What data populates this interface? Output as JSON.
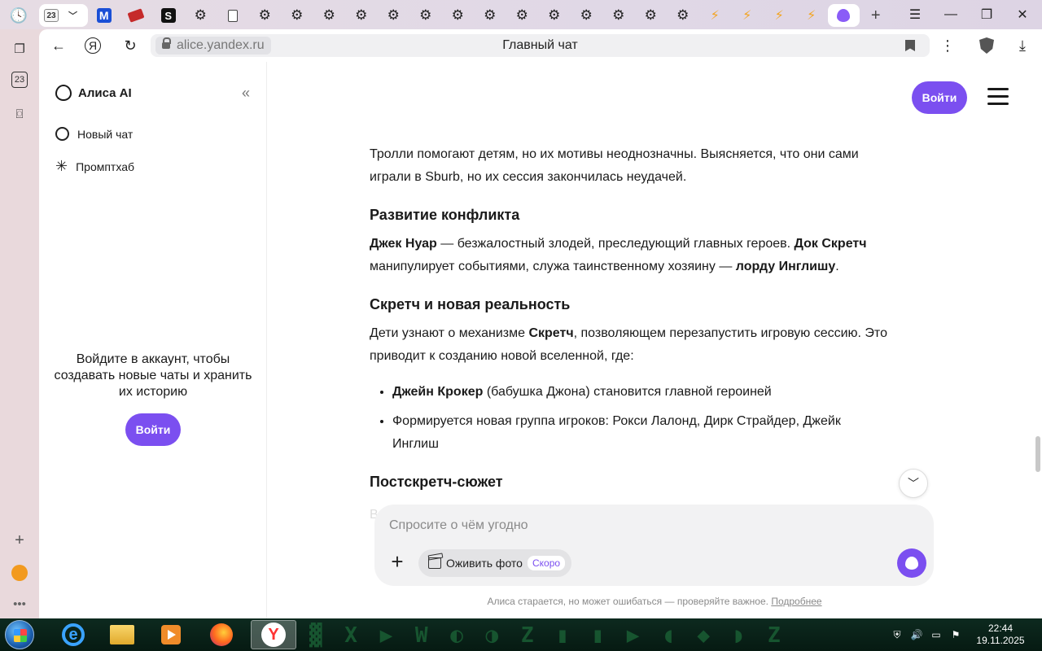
{
  "tabbar": {
    "first_tab_badge": "23",
    "tabs": [
      {
        "icon": "m-icon",
        "glyph": "M"
      },
      {
        "icon": "red-tag-icon",
        "glyph": ""
      },
      {
        "icon": "s-icon",
        "glyph": "S"
      },
      {
        "icon": "gear-icon",
        "glyph": "⚙"
      },
      {
        "icon": "doc-icon",
        "glyph": ""
      },
      {
        "icon": "gear-icon",
        "glyph": "⚙"
      },
      {
        "icon": "gear-icon",
        "glyph": "⚙"
      },
      {
        "icon": "gear-icon",
        "glyph": "⚙"
      },
      {
        "icon": "gear-icon",
        "glyph": "⚙"
      },
      {
        "icon": "gear-icon",
        "glyph": "⚙"
      },
      {
        "icon": "gear-icon",
        "glyph": "⚙"
      },
      {
        "icon": "gear-icon",
        "glyph": "⚙"
      },
      {
        "icon": "gear-icon",
        "glyph": "⚙"
      },
      {
        "icon": "gear-icon",
        "glyph": "⚙"
      },
      {
        "icon": "gear-icon",
        "glyph": "⚙"
      },
      {
        "icon": "gear-icon",
        "glyph": "⚙"
      },
      {
        "icon": "gear-icon",
        "glyph": "⚙"
      },
      {
        "icon": "gear-icon",
        "glyph": "⚙"
      },
      {
        "icon": "gear-icon",
        "glyph": "⚙"
      },
      {
        "icon": "bolt-icon",
        "glyph": "⚡"
      },
      {
        "icon": "bolt-icon",
        "glyph": "⚡"
      },
      {
        "icon": "bolt-icon",
        "glyph": "⚡"
      },
      {
        "icon": "bolt-icon",
        "glyph": "⚡"
      },
      {
        "icon": "alice-icon",
        "glyph": ""
      }
    ]
  },
  "rail": {
    "calendar_badge": "23"
  },
  "address": {
    "url": "alice.yandex.ru",
    "title": "Главный чат"
  },
  "sidebar": {
    "brand": "Алиса AI",
    "new_chat": "Новый чат",
    "prompthub": "Промптхаб",
    "login_prompt": "Войдите в аккаунт, чтобы создавать новые чаты и хранить их историю",
    "login_button": "Войти"
  },
  "main": {
    "login_button": "Войти",
    "para1": "Тролли помогают детям, но их мотивы неоднозначны. Выясняется, что они сами играли в Sburb, но их сессия закончилась неудачей.",
    "h_conflict": "Развитие конфликта",
    "conflict": {
      "b1": "Джек Нуар",
      "t1": " — безжалостный злодей, преследующий главных героев. ",
      "b2": "Док Скретч",
      "t2": " манипулирует событиями, служа таинственному хозяину — ",
      "b3": "лорду Инглишу",
      "t3": "."
    },
    "h_scratch": "Скретч и новая реальность",
    "scratch": {
      "t1": "Дети узнают о механизме ",
      "b1": "Скретч",
      "t2": ", позволяющем перезапустить игровую сессию. Это приводит к созданию новой вселенной, где:"
    },
    "bullets": {
      "b1_bold": "Джейн Крокер",
      "b1_text": " (бабушка Джона) становится главной героиней",
      "b2_text": "Формируется новая группа игроков: Рокси Лалонд, Дирк Страйдер, Джейк Инглиш"
    },
    "h_post": "Постскретч-сюжет",
    "fade_text": "В"
  },
  "composer": {
    "placeholder": "Спросите о чём угодно",
    "revive_label": "Оживить фото",
    "soon_badge": "Скоро"
  },
  "footer": {
    "disclaimer": "Алиса старается, но может ошибаться — проверяйте важное.",
    "more_link": "Подробнее"
  },
  "taskbar": {
    "time": "22:44",
    "date": "19.11.2025"
  },
  "colors": {
    "accent": "#7b4ff0"
  }
}
